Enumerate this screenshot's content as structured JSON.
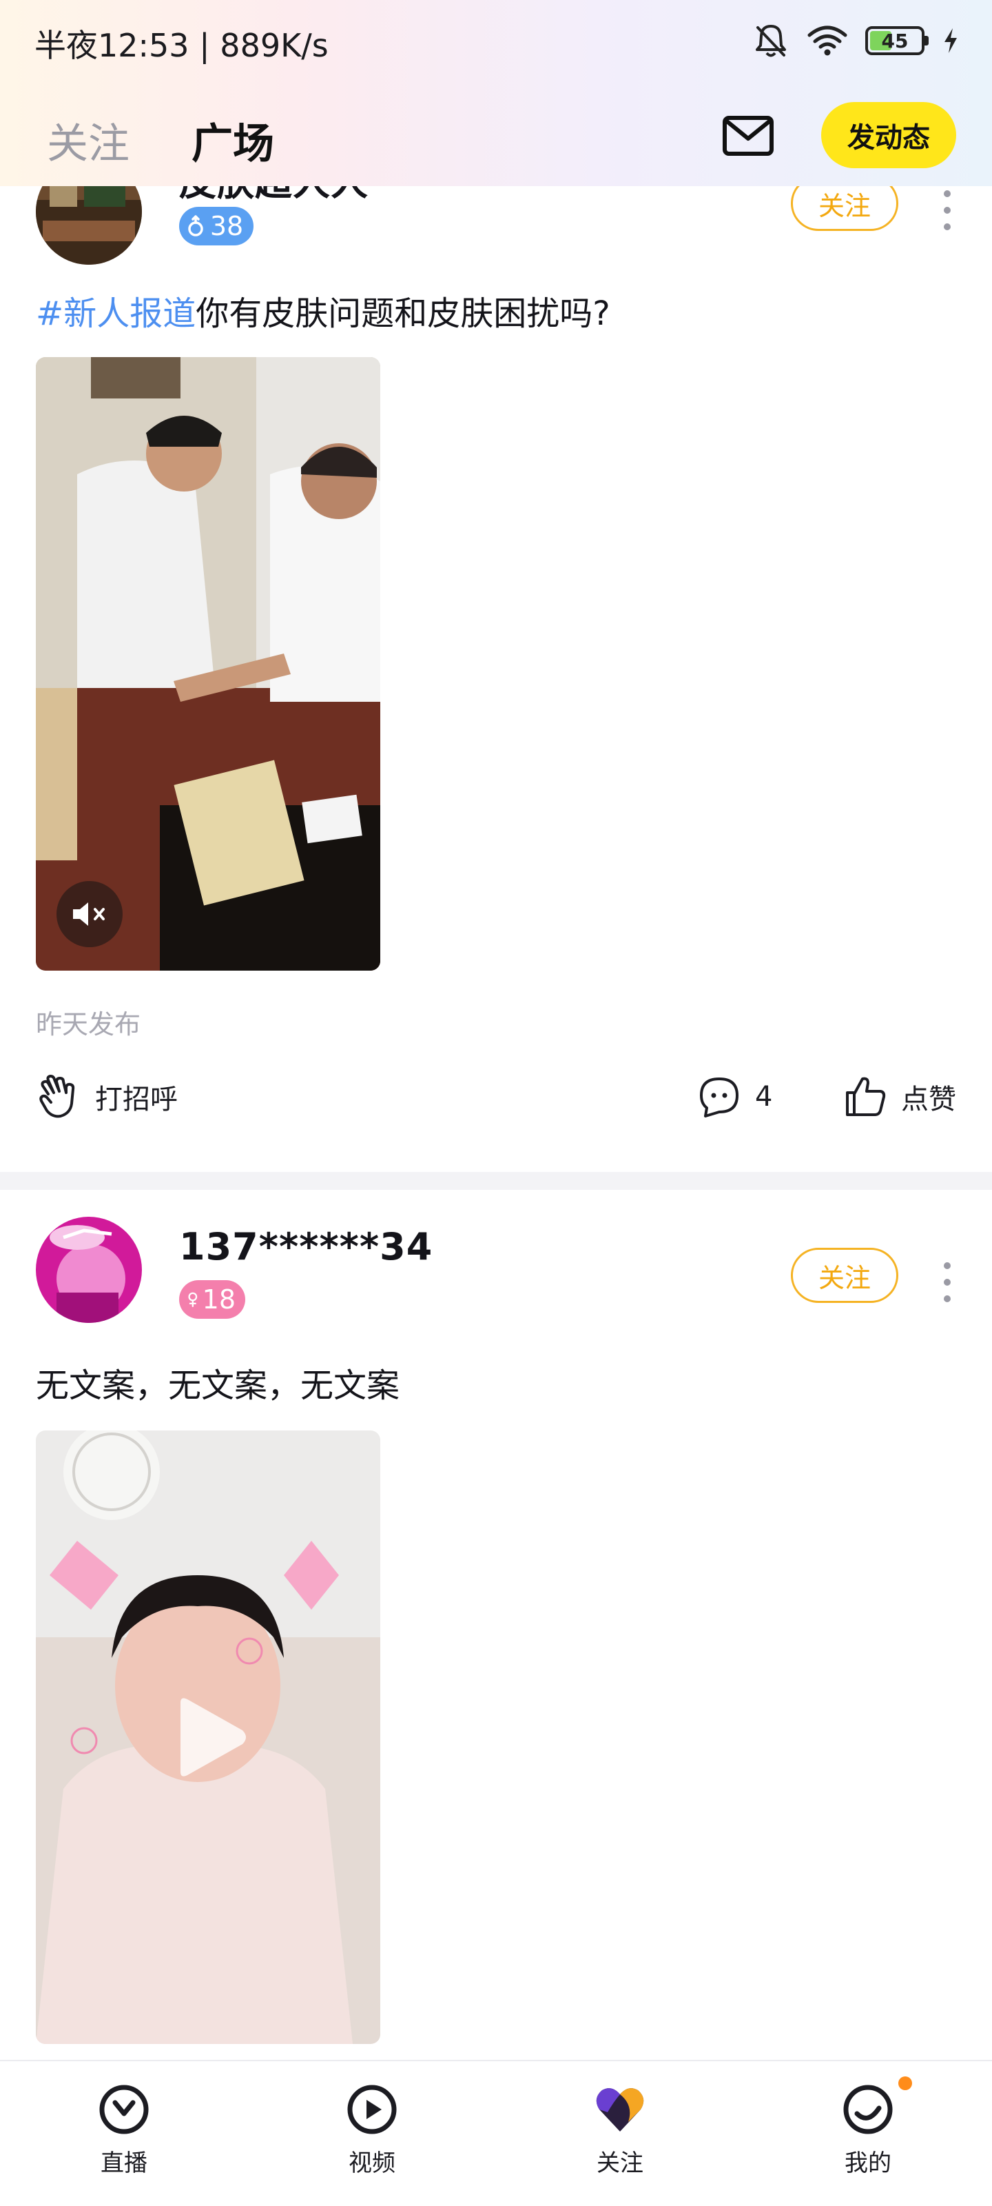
{
  "status_bar": {
    "time_speed": "半夜12:53 | 889K/s",
    "battery": "45"
  },
  "header": {
    "tab_follow": "关注",
    "tab_square": "广场",
    "post_button": "发动态"
  },
  "posts": [
    {
      "username": "皮肤超人人",
      "badge": "38",
      "gender": "male",
      "follow_label": "关注",
      "tag": "#新人报道",
      "caption": "你有皮肤问题和皮肤困扰吗?",
      "posted": "昨天发布",
      "greet_label": "打招呼",
      "comment_count": "4",
      "like_label": "点赞"
    },
    {
      "username": "137******34",
      "badge": "18",
      "gender": "female",
      "follow_label": "关注",
      "caption": "无文案，无文案，无文案"
    }
  ],
  "bottom_nav": [
    {
      "label": "直播",
      "icon": "live-icon"
    },
    {
      "label": "视频",
      "icon": "video-icon"
    },
    {
      "label": "关注",
      "icon": "heart-icon"
    },
    {
      "label": "我的",
      "icon": "profile-icon"
    }
  ],
  "colors": {
    "accent_yellow": "#ffe61a",
    "follow_orange": "#f5b324",
    "tag_blue": "#4d8ff0"
  }
}
